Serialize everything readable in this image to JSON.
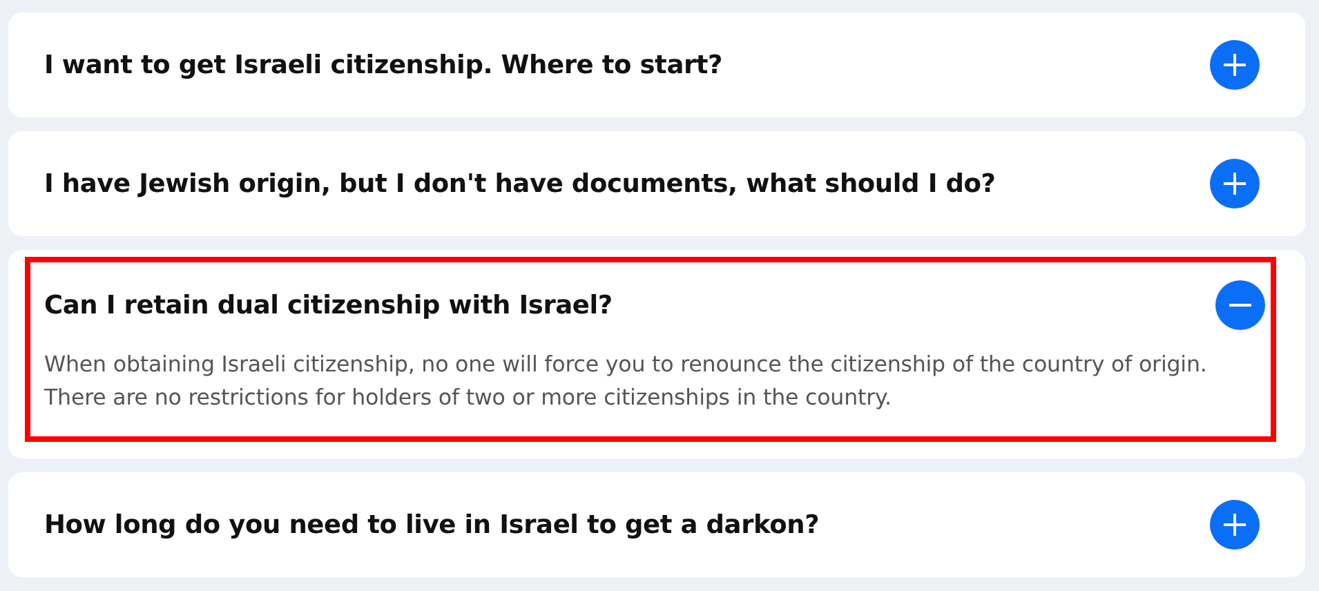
{
  "faq": [
    {
      "question": "I want to get Israeli citizenship. Where to start?",
      "expanded": false,
      "highlighted": false
    },
    {
      "question": "I have Jewish origin, but I don't have documents, what should I do?",
      "expanded": false,
      "highlighted": false
    },
    {
      "question": "Can I retain dual citizenship with Israel?",
      "expanded": true,
      "highlighted": true,
      "answer": "When obtaining Israeli citizenship, no one will force you to renounce the citizenship of the country of origin. There are no restrictions for holders of two or more citizenships in the country."
    },
    {
      "question": "How long do you need to live in Israel to get a darkon?",
      "expanded": false,
      "highlighted": false
    }
  ]
}
